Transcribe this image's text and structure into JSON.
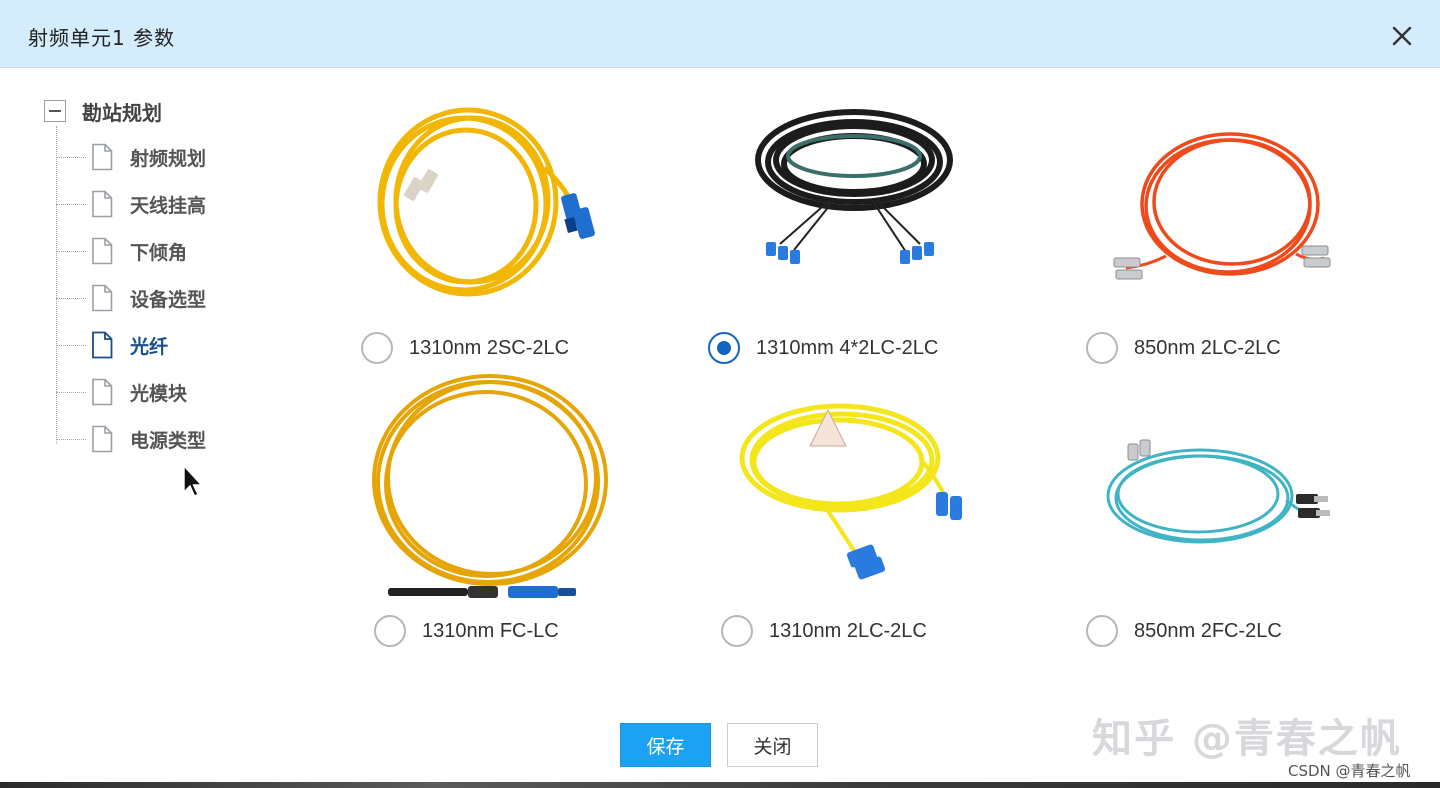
{
  "dialog": {
    "title": "射频单元1 参数",
    "close_icon": "close-icon"
  },
  "tree": {
    "root_label": "勘站规划",
    "items": [
      {
        "label": "射频规划",
        "selected": false
      },
      {
        "label": "天线挂高",
        "selected": false
      },
      {
        "label": "下倾角",
        "selected": false
      },
      {
        "label": "设备选型",
        "selected": false
      },
      {
        "label": "光纤",
        "selected": true
      },
      {
        "label": "光模块",
        "selected": false
      },
      {
        "label": "电源类型",
        "selected": false
      }
    ]
  },
  "fiber_options": [
    {
      "label": "1310nm 2SC-2LC",
      "checked": false,
      "cable_color": "#f2b705",
      "icon": "yellow-fiber-coil-image"
    },
    {
      "label": "1310mm 4*2LC-2LC",
      "checked": true,
      "cable_color": "#1c1c1c",
      "icon": "black-fiber-coil-image"
    },
    {
      "label": "850nm 2LC-2LC",
      "checked": false,
      "cable_color": "#ef4a1c",
      "icon": "orange-fiber-coil-image"
    },
    {
      "label": "1310nm FC-LC",
      "checked": false,
      "cable_color": "#e6a506",
      "icon": "yellow-fiber-loop-image"
    },
    {
      "label": "1310nm 2LC-2LC",
      "checked": false,
      "cable_color": "#f4e61a",
      "icon": "yellow-fiber-coil-lc-image"
    },
    {
      "label": "850nm 2FC-2LC",
      "checked": false,
      "cable_color": "#3fb4c4",
      "icon": "aqua-fiber-coil-image"
    }
  ],
  "buttons": {
    "save_label": "保存",
    "close_label": "关闭"
  },
  "watermarks": {
    "zhihu": "知乎 @青春之帆",
    "csdn": "CSDN @青春之帆"
  },
  "colors": {
    "titlebar_bg": "#d4ecfb",
    "accent": "#1565c0",
    "save_button": "#1da1f2"
  }
}
